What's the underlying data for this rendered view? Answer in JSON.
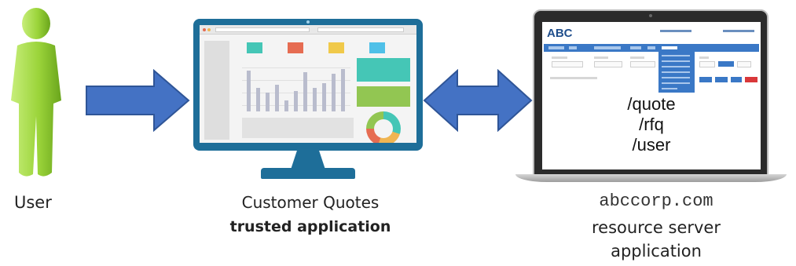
{
  "nodes": {
    "user": {
      "label": "User"
    },
    "client_app": {
      "label_line1": "Customer Quotes",
      "label_line2": "trusted application"
    },
    "resource_server": {
      "domain": "abccorp.com",
      "label_line1": "resource server",
      "label_line2": "application",
      "routes": [
        "/quote",
        "/rfq",
        "/user"
      ],
      "logo": "ABC"
    }
  },
  "arrows": [
    {
      "from": "user",
      "to": "client_app",
      "direction": "one-way"
    },
    {
      "from": "client_app",
      "to": "resource_server",
      "direction": "two-way"
    }
  ],
  "colors": {
    "arrow": "#4472c4",
    "arrow_outline": "#2f5597",
    "user_figure": "#9bd43a",
    "monitor": "#1e6e99",
    "teal": "#45c6b6",
    "green": "#92c652"
  }
}
